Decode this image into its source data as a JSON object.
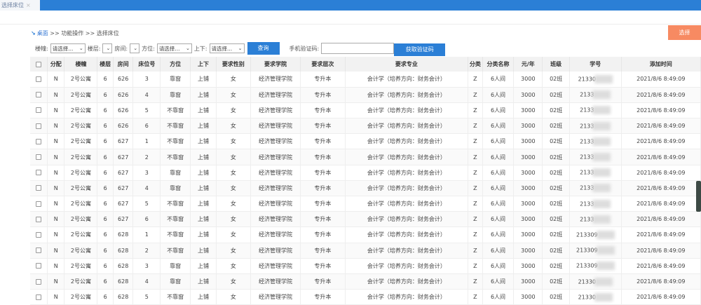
{
  "tab": {
    "label": "选择床位",
    "close": "×"
  },
  "breadcrumb": {
    "home": "桌面",
    "sep": ">>",
    "level2": "功能操作",
    "level3": "选择床位"
  },
  "select_button": "选择",
  "filters": {
    "building_label": "楼幢:",
    "building_value": "请选择...",
    "floor_label": "楼层:",
    "floor_value": "",
    "room_label": "房间:",
    "room_value": "",
    "direction_label": "方位:",
    "direction_value": "请选择...",
    "updown_label": "上下:",
    "updown_value": "请选择...",
    "query": "查询",
    "code_label": "手机验证码:",
    "code_value": "",
    "get_code": "获取验证码"
  },
  "columns": [
    "分配",
    "楼幢",
    "楼层",
    "房间",
    "床位号",
    "方位",
    "上下",
    "要求性别",
    "要求学院",
    "要求层次",
    "要求专业",
    "分类",
    "分类名称",
    "元/年",
    "班级",
    "学号",
    "添加时间"
  ],
  "rows": [
    [
      "N",
      "2号公寓",
      "6",
      "626",
      "3",
      "靠窗",
      "上铺",
      "女",
      "经济管理学院",
      "专升本",
      "会计学（培养方向：财务会计）",
      "Z",
      "6人间",
      "3000",
      "02班",
      "21330",
      "2021/8/6 8:49:09"
    ],
    [
      "N",
      "2号公寓",
      "6",
      "626",
      "4",
      "靠窗",
      "上铺",
      "女",
      "经济管理学院",
      "专升本",
      "会计学（培养方向：财务会计）",
      "Z",
      "6人间",
      "3000",
      "02班",
      "2133",
      "2021/8/6 8:49:09"
    ],
    [
      "N",
      "2号公寓",
      "6",
      "626",
      "5",
      "不靠窗",
      "上铺",
      "女",
      "经济管理学院",
      "专升本",
      "会计学（培养方向：财务会计）",
      "Z",
      "6人间",
      "3000",
      "02班",
      "2133",
      "2021/8/6 8:49:09"
    ],
    [
      "N",
      "2号公寓",
      "6",
      "626",
      "6",
      "不靠窗",
      "上铺",
      "女",
      "经济管理学院",
      "专升本",
      "会计学（培养方向：财务会计）",
      "Z",
      "6人间",
      "3000",
      "02班",
      "2133",
      "2021/8/6 8:49:09"
    ],
    [
      "N",
      "2号公寓",
      "6",
      "627",
      "1",
      "不靠窗",
      "上铺",
      "女",
      "经济管理学院",
      "专升本",
      "会计学（培养方向：财务会计）",
      "Z",
      "6人间",
      "3000",
      "02班",
      "2133",
      "2021/8/6 8:49:09"
    ],
    [
      "N",
      "2号公寓",
      "6",
      "627",
      "2",
      "不靠窗",
      "上铺",
      "女",
      "经济管理学院",
      "专升本",
      "会计学（培养方向：财务会计）",
      "Z",
      "6人间",
      "3000",
      "02班",
      "2133",
      "2021/8/6 8:49:09"
    ],
    [
      "N",
      "2号公寓",
      "6",
      "627",
      "3",
      "靠窗",
      "上铺",
      "女",
      "经济管理学院",
      "专升本",
      "会计学（培养方向：财务会计）",
      "Z",
      "6人间",
      "3000",
      "02班",
      "2133",
      "2021/8/6 8:49:09"
    ],
    [
      "N",
      "2号公寓",
      "6",
      "627",
      "4",
      "靠窗",
      "上铺",
      "女",
      "经济管理学院",
      "专升本",
      "会计学（培养方向：财务会计）",
      "Z",
      "6人间",
      "3000",
      "02班",
      "2133",
      "2021/8/6 8:49:09"
    ],
    [
      "N",
      "2号公寓",
      "6",
      "627",
      "5",
      "不靠窗",
      "上铺",
      "女",
      "经济管理学院",
      "专升本",
      "会计学（培养方向：财务会计）",
      "Z",
      "6人间",
      "3000",
      "02班",
      "2133",
      "2021/8/6 8:49:09"
    ],
    [
      "N",
      "2号公寓",
      "6",
      "627",
      "6",
      "不靠窗",
      "上铺",
      "女",
      "经济管理学院",
      "专升本",
      "会计学（培养方向：财务会计）",
      "Z",
      "6人间",
      "3000",
      "02班",
      "2133",
      "2021/8/6 8:49:09"
    ],
    [
      "N",
      "2号公寓",
      "6",
      "628",
      "1",
      "不靠窗",
      "上铺",
      "女",
      "经济管理学院",
      "专升本",
      "会计学（培养方向：财务会计）",
      "Z",
      "6人间",
      "3000",
      "02班",
      "213309",
      "2021/8/6 8:49:09"
    ],
    [
      "N",
      "2号公寓",
      "6",
      "628",
      "2",
      "不靠窗",
      "上铺",
      "女",
      "经济管理学院",
      "专升本",
      "会计学（培养方向：财务会计）",
      "Z",
      "6人间",
      "3000",
      "02班",
      "213309",
      "2021/8/6 8:49:09"
    ],
    [
      "N",
      "2号公寓",
      "6",
      "628",
      "3",
      "靠窗",
      "上铺",
      "女",
      "经济管理学院",
      "专升本",
      "会计学（培养方向：财务会计）",
      "Z",
      "6人间",
      "3000",
      "02班",
      "213309",
      "2021/8/6 8:49:09"
    ],
    [
      "N",
      "2号公寓",
      "6",
      "628",
      "4",
      "靠窗",
      "上铺",
      "女",
      "经济管理学院",
      "专升本",
      "会计学（培养方向：财务会计）",
      "Z",
      "6人间",
      "3000",
      "02班",
      "21330",
      "2021/8/6 8:49:09"
    ],
    [
      "N",
      "2号公寓",
      "6",
      "628",
      "5",
      "不靠窗",
      "上铺",
      "女",
      "经济管理学院",
      "专升本",
      "会计学（培养方向：财务会计）",
      "Z",
      "6人间",
      "3000",
      "02班",
      "21330",
      "2021/8/6 8:49:09"
    ]
  ]
}
